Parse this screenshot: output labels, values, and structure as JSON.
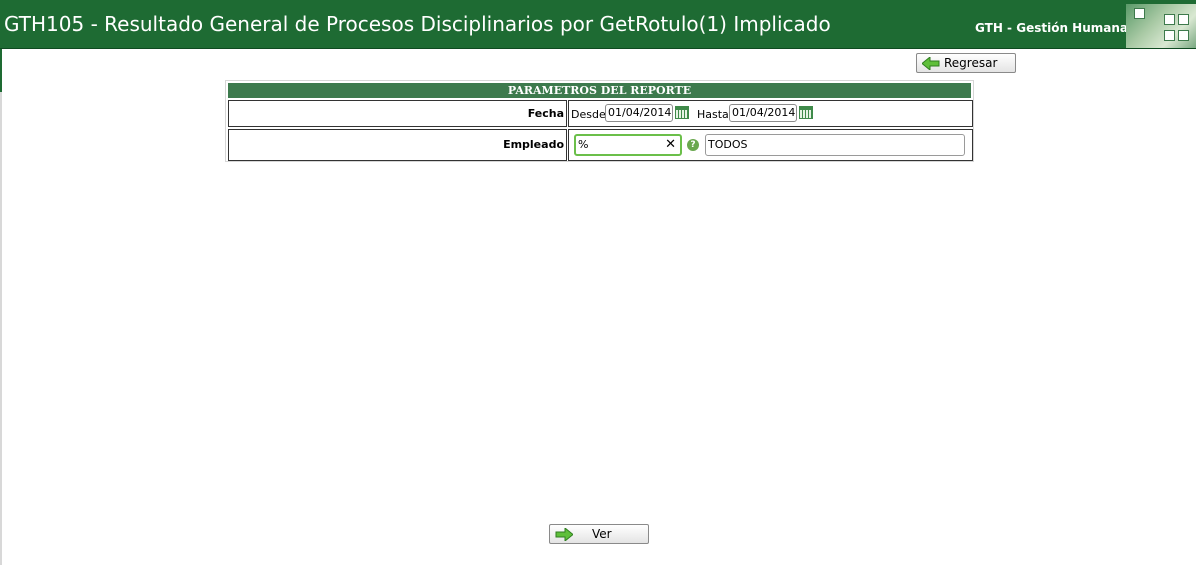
{
  "header": {
    "title": "GTH105 - Resultado General de Procesos Disciplinarios por GetRotulo(1) Implicado",
    "app_name": "GTH - Gestión Humana"
  },
  "toolbar": {
    "back_label": "Regresar",
    "ver_label": "Ver"
  },
  "params": {
    "heading": "PARAMETROS DEL REPORTE",
    "fecha_label": "Fecha",
    "desde_label": "Desde:",
    "desde_value": "01/04/2014",
    "hasta_label": "Hasta:",
    "hasta_value": "01/04/2014",
    "empleado_label": "Empleado",
    "empleado_value": "%",
    "empleado_name": "TODOS",
    "clear_symbol": "✕",
    "help_symbol": "?"
  },
  "icons": {
    "back": "arrow-left-icon",
    "ver": "arrow-right-icon",
    "calendar": "calendar-icon",
    "help": "help-icon",
    "clear": "close-icon",
    "logo": "people-logo-icon"
  },
  "colors": {
    "brand_green": "#1e6b33",
    "panel_header": "#3d7a4d",
    "focus_green": "#6bbf4a"
  }
}
